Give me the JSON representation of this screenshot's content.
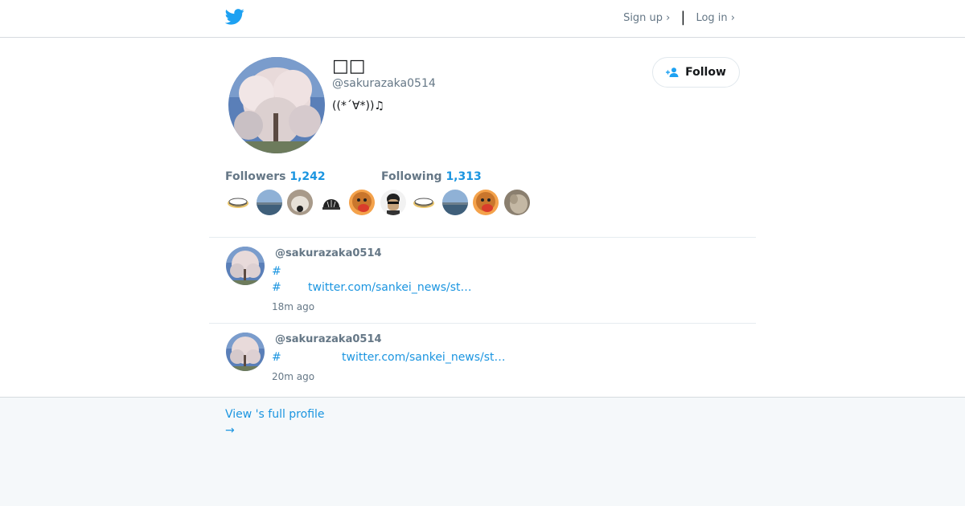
{
  "header": {
    "logo_icon": "twitter-bird-icon",
    "signup_label": "Sign up ›",
    "separator": "|",
    "login_label": "Log in ›"
  },
  "profile": {
    "display_name": "□□",
    "handle": "@sakurazaka0514",
    "bio": "((*´∀*))♫",
    "follow_label": "Follow",
    "followers_label": "Followers",
    "followers_count": "1,242",
    "following_label": "Following",
    "following_count": "1,313"
  },
  "tweets": [
    {
      "user": "@sakurazaka0514",
      "lines": [
        {
          "hash": "#",
          "link": ""
        },
        {
          "hash": "#",
          "link": "twitter.com/sankei_news/st…"
        }
      ],
      "time": "18m ago"
    },
    {
      "user": "@sakurazaka0514",
      "lines": [
        {
          "hash": "#",
          "link": "twitter.com/sankei_news/st…"
        }
      ],
      "time": "20m ago"
    }
  ],
  "footer": {
    "full_profile_label": "View 's full profile",
    "arrow": "→"
  },
  "colors": {
    "link": "#1b95e0",
    "muted": "#657786",
    "brand": "#1da1f2"
  }
}
